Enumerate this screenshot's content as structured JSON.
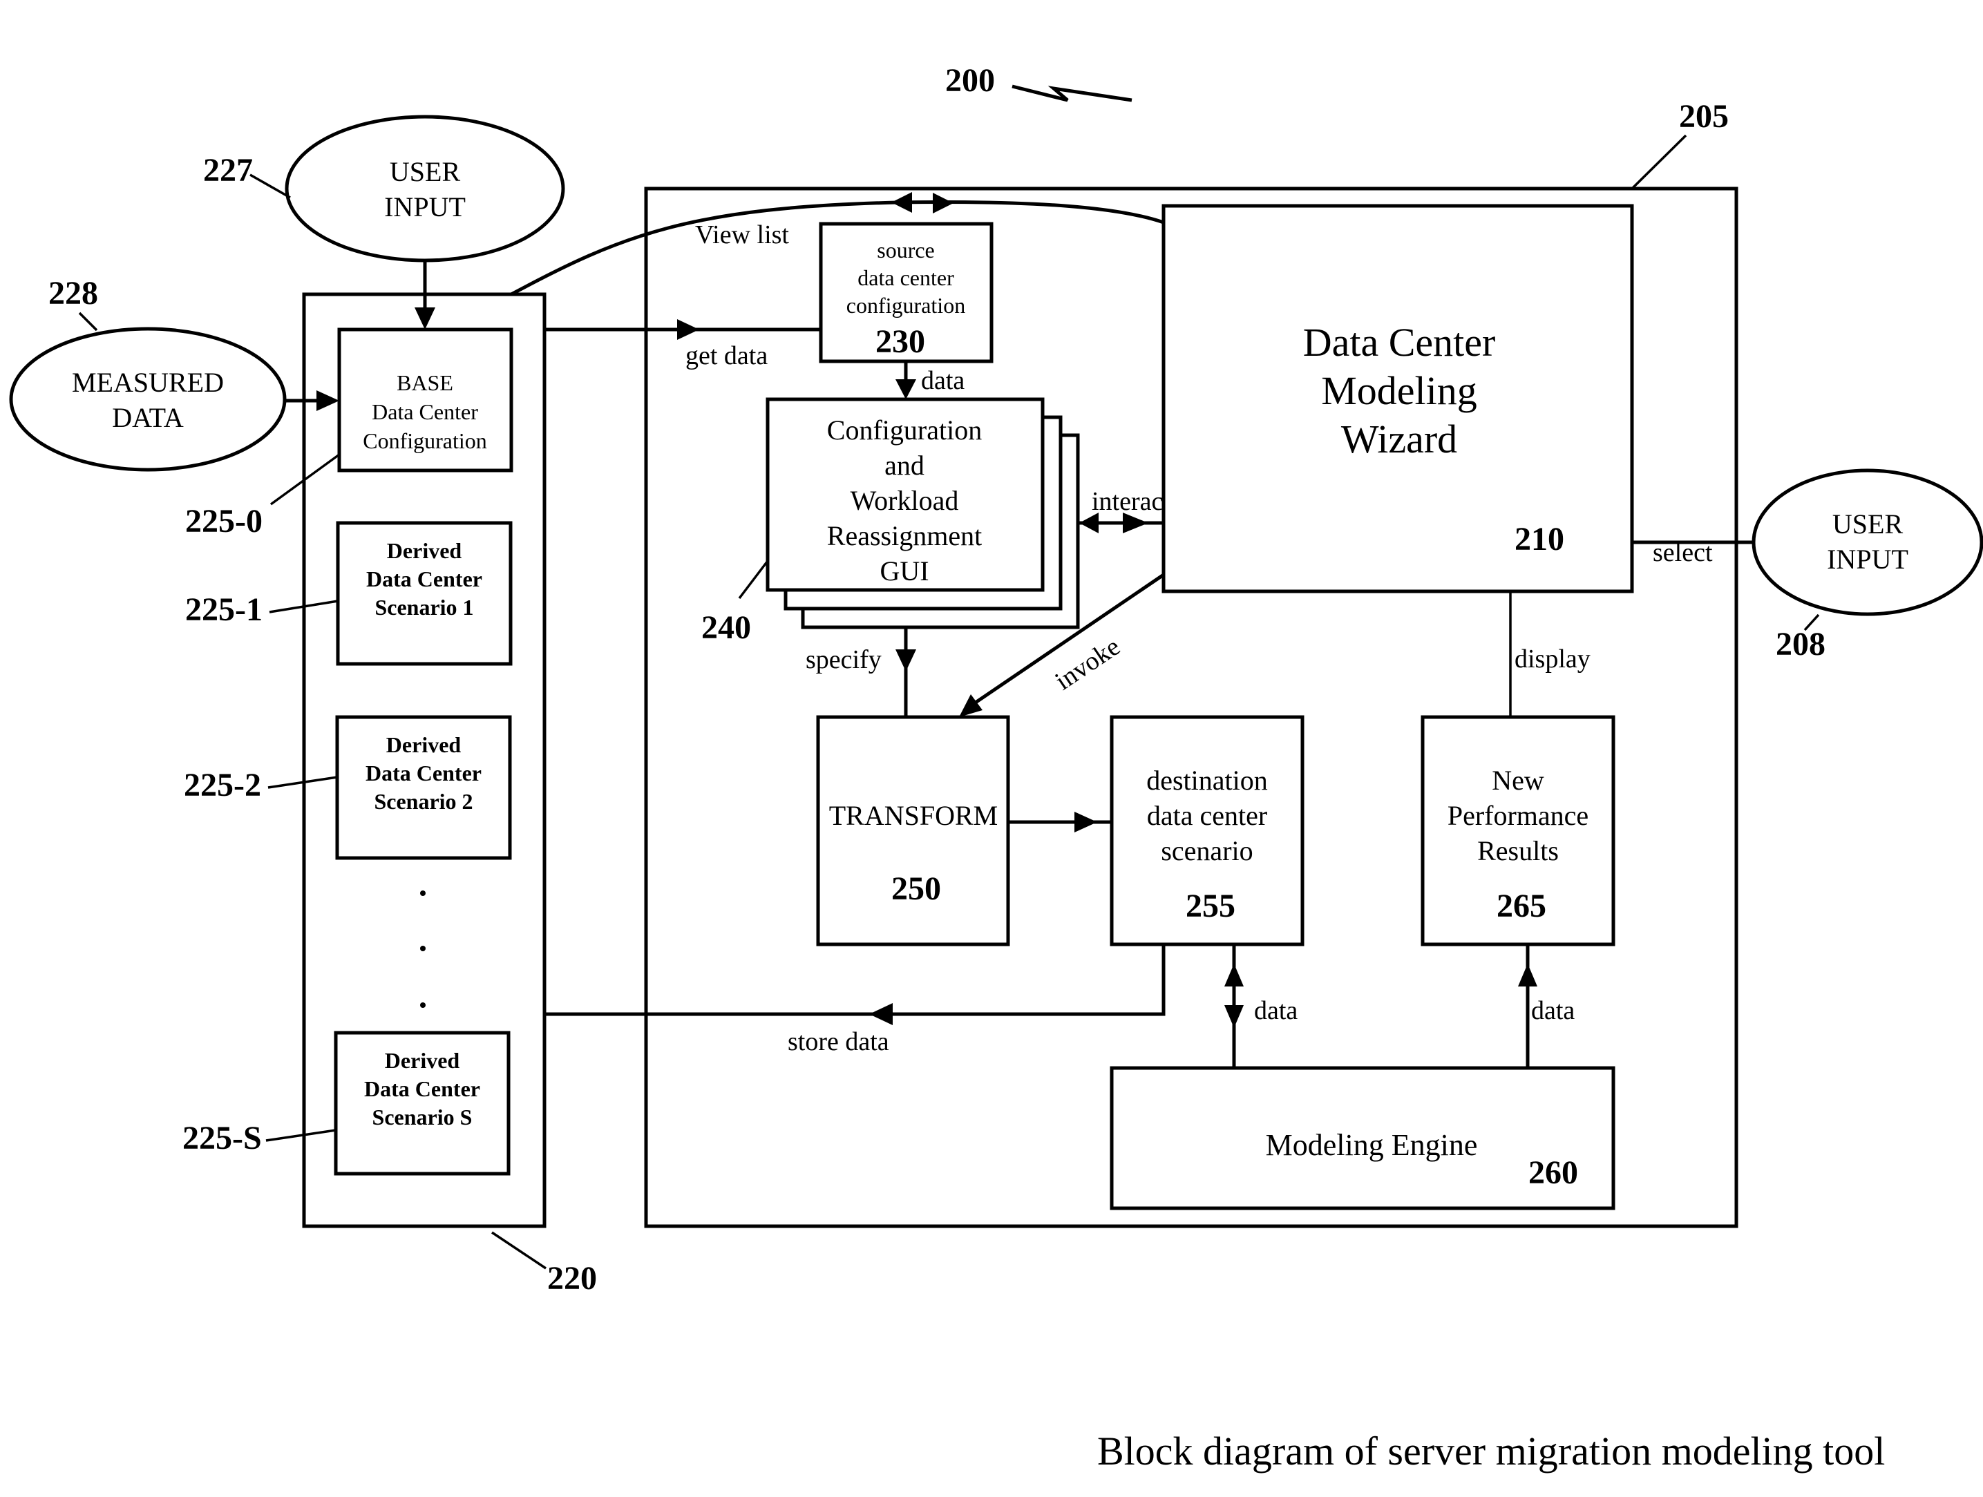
{
  "figure": {
    "reference": "200",
    "caption": "Block diagram of server migration modeling tool"
  },
  "inputs": {
    "user_input_top": {
      "ref": "227",
      "lines": [
        "USER",
        "INPUT"
      ]
    },
    "measured_data": {
      "ref": "228",
      "lines": [
        "MEASURED",
        "DATA"
      ]
    },
    "user_input_right": {
      "ref": "208",
      "lines": [
        "USER",
        "INPUT"
      ]
    }
  },
  "repository": {
    "ref": "220",
    "items": [
      {
        "ref": "225-0",
        "lines": [
          "BASE",
          "Data Center",
          "Configuration"
        ]
      },
      {
        "ref": "225-1",
        "lines": [
          "Derived",
          "Data Center",
          "Scenario 1"
        ]
      },
      {
        "ref": "225-2",
        "lines": [
          "Derived",
          "Data Center",
          "Scenario 2"
        ]
      },
      {
        "ref": "225-S",
        "lines": [
          "Derived",
          "Data Center",
          "Scenario S"
        ]
      }
    ],
    "ellipsis": "• • •"
  },
  "tool": {
    "ref": "205",
    "source_config": {
      "ref": "230",
      "lines": [
        "source",
        "data center",
        "configuration"
      ]
    },
    "gui": {
      "ref": "240",
      "lines": [
        "Configuration",
        "and",
        "Workload",
        "Reassignment",
        "GUI"
      ]
    },
    "wizard": {
      "ref": "210",
      "lines": [
        "Data Center",
        "Modeling",
        "Wizard"
      ]
    },
    "transform": {
      "ref": "250",
      "lines": [
        "TRANSFORM"
      ]
    },
    "destination": {
      "ref": "255",
      "lines": [
        "destination",
        "data center",
        "scenario"
      ]
    },
    "results": {
      "ref": "265",
      "lines": [
        "New",
        "Performance",
        "Results"
      ]
    },
    "engine": {
      "ref": "260",
      "lines": [
        "Modeling Engine"
      ]
    }
  },
  "connections": {
    "view_list": "View list",
    "get_data": "get data",
    "data_source_to_gui": "data",
    "interact": "interact",
    "invoke": "invoke",
    "specify": "specify",
    "select": "select",
    "display": "display",
    "store_data": "store data",
    "data_engine_dest": "data",
    "data_engine_results": "data"
  }
}
